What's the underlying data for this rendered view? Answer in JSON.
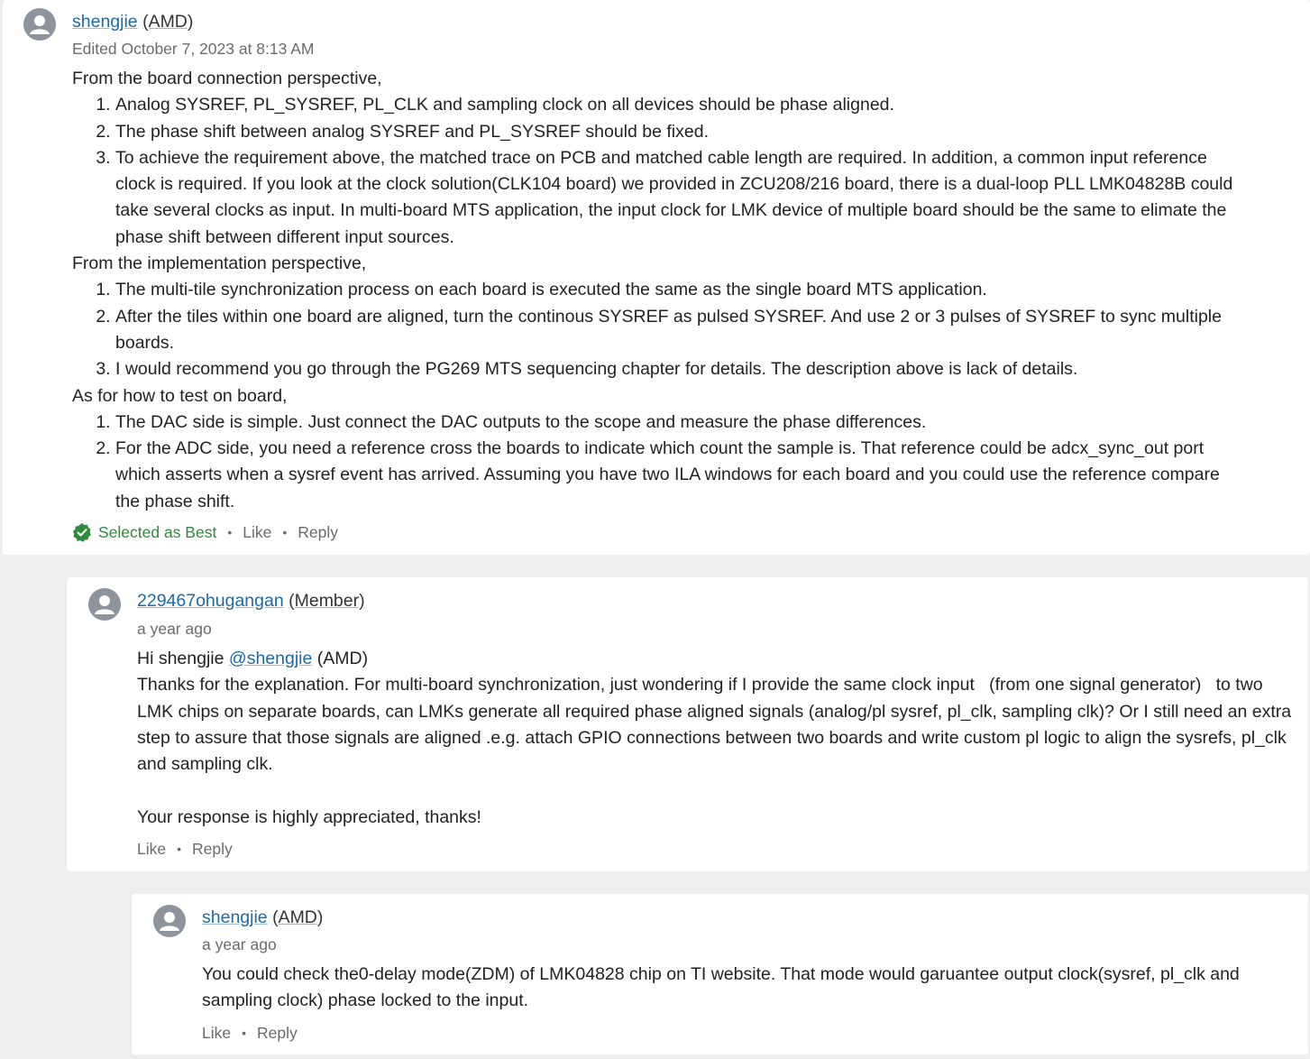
{
  "colors": {
    "link": "#1e6aa6",
    "best": "#2f8a3c",
    "meta": "#6b6b6b",
    "avatar": "#8d949e"
  },
  "comments": [
    {
      "author": "shengjie",
      "role": "(AMD)",
      "meta": "Edited October 7, 2023 at 8:13 AM",
      "sections": [
        {
          "heading": "From the board connection perspective,",
          "items": [
            "Analog SYSREF, PL_SYSREF, PL_CLK and sampling clock on all devices should be phase aligned.",
            "The phase shift between analog SYSREF and PL_SYSREF should be fixed.",
            "To achieve the requirement above, the matched trace on PCB and matched cable length are required. In addition, a common input reference clock is required. If you look at the clock solution(CLK104 board) we provided in ZCU208/216 board, there is a dual-loop PLL LMK04828B could take several clocks as input. In multi-board MTS application, the input clock for LMK device of multiple board should be the same to elimate the phase shift between different input sources."
          ]
        },
        {
          "heading": "From the implementation perspective,",
          "items": [
            "The multi-tile synchronization process on each board is executed the same as the single board MTS application.",
            "After the tiles within one board are aligned, turn the continous SYSREF as pulsed SYSREF. And use 2 or 3 pulses of SYSREF to sync multiple boards.",
            "I would recommend you go through the PG269 MTS sequencing chapter for details. The description above is lack of details."
          ]
        },
        {
          "heading": "As for how to test on board,",
          "items": [
            "The DAC side is simple. Just connect the DAC outputs to the scope and measure the phase differences.",
            "For the ADC side, you need a reference cross the boards to indicate which count the sample is. That reference could be adcx_sync_out port which asserts when a sysref event has arrived. Assuming you have two ILA windows for each board and you could use the reference compare the phase shift."
          ]
        }
      ],
      "best_label": "Selected as Best",
      "like_label": "Like",
      "reply_label": "Reply"
    },
    {
      "author": "229467ohugangan",
      "role": "(Member)",
      "meta": "a year ago",
      "greeting": "Hi shengjie",
      "mention": "@shengjie",
      "mention_role": "(AMD)",
      "paragraph1": "Thanks for the explanation. For multi-board synchronization, just wondering if I provide the same clock input   (from one signal generator)   to two LMK chips on separate boards, can LMKs generate all required phase aligned signals (analog/pl sysref, pl_clk, sampling clk)? Or I still need an extra step to assure that those signals are aligned .e.g. attach GPIO connections between two boards and write custom pl logic to align the sysrefs, pl_clk and sampling clk.",
      "paragraph2": "Your response is highly appreciated, thanks!",
      "like_label": "Like",
      "reply_label": "Reply"
    },
    {
      "author": "shengjie",
      "role": "(AMD)",
      "meta": "a year ago",
      "paragraph1": "You could check the0-delay mode(ZDM) of LMK04828 chip on TI website. That mode would garuantee output clock(sysref, pl_clk and sampling clock) phase locked to the input.",
      "like_label": "Like",
      "reply_label": "Reply"
    }
  ]
}
